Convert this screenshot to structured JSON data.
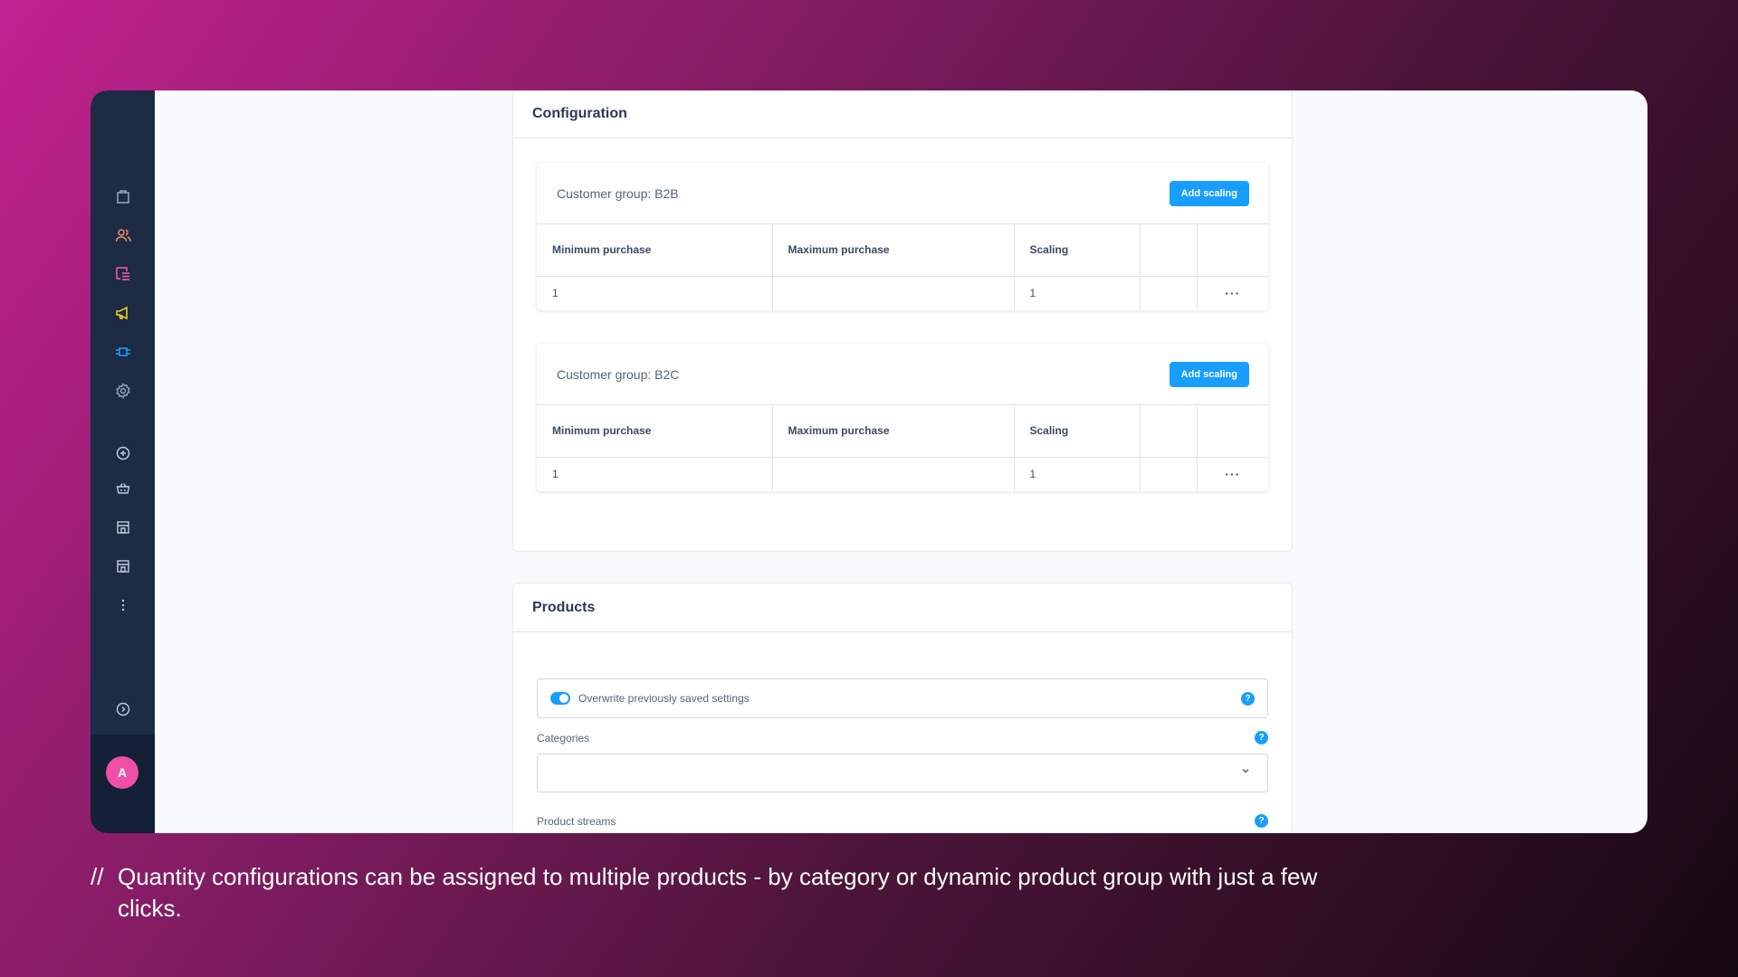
{
  "sidebar": {
    "icons": [
      "bag-icon",
      "users-icon",
      "list-icon",
      "megaphone-icon",
      "plugin-icon",
      "settings-icon",
      "add-circle-icon",
      "basket-icon",
      "store-icon",
      "store-icon-2",
      "more-icon",
      "play-circle-icon"
    ],
    "icon_colors": [
      "#9aa9c2",
      "#f48a63",
      "#ff58b6",
      "#f7d51a",
      "#189eff",
      "#9aa9c2"
    ],
    "avatar_initial": "A"
  },
  "configuration": {
    "title": "Configuration",
    "groups": [
      {
        "title": "Customer group: B2B",
        "add_button": "Add scaling",
        "columns": [
          "Minimum purchase",
          "Maximum purchase",
          "Scaling",
          "",
          ""
        ],
        "rows": [
          [
            "1",
            "",
            "1",
            "",
            "···"
          ]
        ]
      },
      {
        "title": "Customer group: B2C",
        "add_button": "Add scaling",
        "columns": [
          "Minimum purchase",
          "Maximum purchase",
          "Scaling",
          "",
          ""
        ],
        "rows": [
          [
            "1",
            "",
            "1",
            "",
            "···"
          ]
        ]
      }
    ]
  },
  "products": {
    "title": "Products",
    "overwrite_label": "Overwrite previously saved settings",
    "overwrite_enabled": true,
    "categories_label": "Categories",
    "categories_value": "",
    "product_streams_label": "Product streams",
    "help_glyph": "?"
  },
  "caption": {
    "prefix": "//",
    "text": "Quantity configurations can be assigned to multiple products - by category or dynamic product group with just a few clicks."
  },
  "colors": {
    "accent": "#189eff",
    "sidebar": "#1d2b45",
    "avatar": "#ef4fa7"
  }
}
